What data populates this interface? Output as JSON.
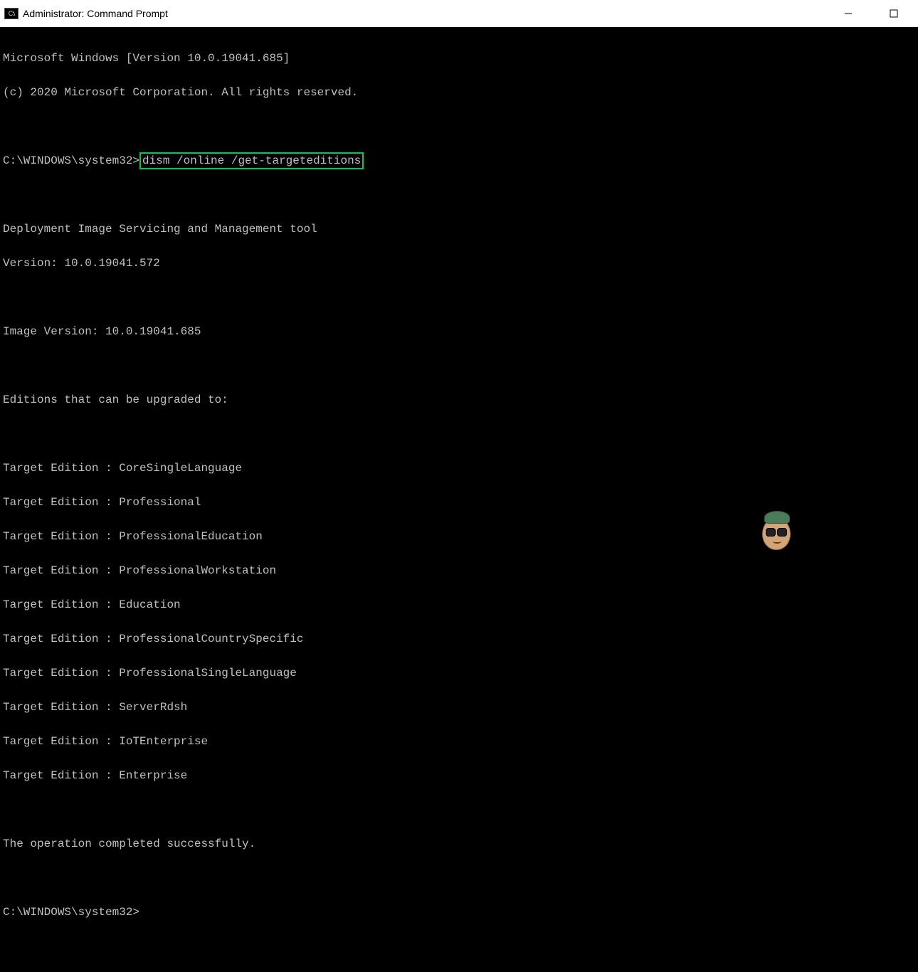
{
  "window": {
    "title": "Administrator: Command Prompt"
  },
  "terminal": {
    "line1": "Microsoft Windows [Version 10.0.19041.685]",
    "line2": "(c) 2020 Microsoft Corporation. All rights reserved.",
    "prompt1": "C:\\WINDOWS\\system32>",
    "command": "dism /online /get-targeteditions",
    "tool_name": "Deployment Image Servicing and Management tool",
    "tool_version": "Version: 10.0.19041.572",
    "image_version": "Image Version: 10.0.19041.685",
    "editions_header": "Editions that can be upgraded to:",
    "editions": [
      "Target Edition : CoreSingleLanguage",
      "Target Edition : Professional",
      "Target Edition : ProfessionalEducation",
      "Target Edition : ProfessionalWorkstation",
      "Target Edition : Education",
      "Target Edition : ProfessionalCountrySpecific",
      "Target Edition : ProfessionalSingleLanguage",
      "Target Edition : ServerRdsh",
      "Target Edition : IoTEnterprise",
      "Target Edition : Enterprise"
    ],
    "result": "The operation completed successfully.",
    "prompt2": "C:\\WINDOWS\\system32>"
  }
}
